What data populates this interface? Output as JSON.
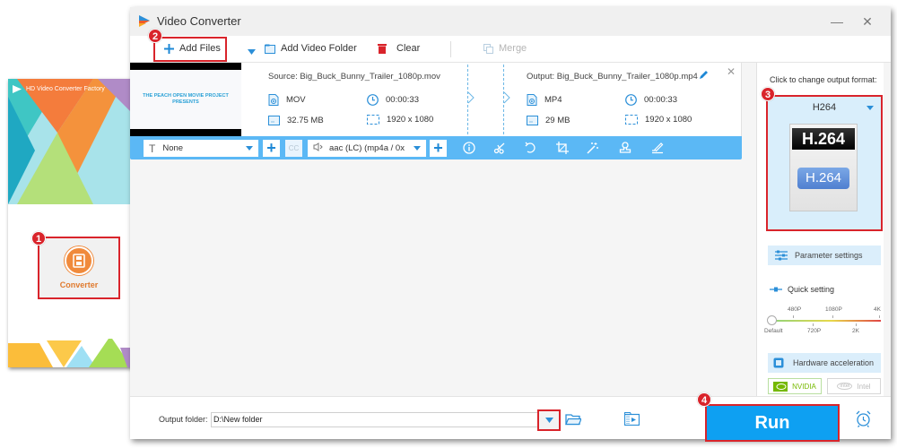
{
  "launcher": {
    "title": "HD Video Converter Factory",
    "converter_label": "Converter",
    "step_badge": "1"
  },
  "window": {
    "title": "Video Converter",
    "minimize": "—",
    "close": "✕"
  },
  "toolbar": {
    "add_files": "Add Files",
    "add_files_badge": "2",
    "add_video_folder": "Add Video Folder",
    "clear": "Clear",
    "merge": "Merge"
  },
  "file": {
    "thumbnail_text": "THE PEACH OPEN MOVIE PROJECT PRESENTS",
    "source": {
      "label": "Source: Big_Buck_Bunny_Trailer_1080p.mov",
      "format": "MOV",
      "duration": "00:00:33",
      "size": "32.75 MB",
      "resolution": "1920 x 1080"
    },
    "output": {
      "label": "Output: Big_Buck_Bunny_Trailer_1080p.mp4",
      "format": "MP4",
      "duration": "00:00:33",
      "size": "29 MB",
      "resolution": "1920 x 1080"
    },
    "close": "✕"
  },
  "editbar": {
    "subtitle_value": "None",
    "cc_label": "CC",
    "audio_value": "aac (LC) (mp4a / 0x",
    "tools": [
      "info-icon",
      "scissors-icon",
      "rotate-icon",
      "crop-icon",
      "effects-wand-icon",
      "watermark-stamp-icon",
      "edit-sign-icon"
    ]
  },
  "right_panel": {
    "change_format_label": "Click to change output format:",
    "format_name": "H264",
    "format_card_top": "H.264",
    "format_card_button": "H.264",
    "format_badge": "3",
    "parameter_settings": "Parameter settings",
    "quick_setting": "Quick setting",
    "quality_top_ticks": [
      "480P",
      "1080P",
      "4K"
    ],
    "quality_bottom_ticks": [
      "Default",
      "720P",
      "2K"
    ],
    "quality_value": "Default",
    "hardware_acceleration": "Hardware acceleration",
    "nvidia": "NVIDIA",
    "intel": "Intel",
    "intel_logo": "intel"
  },
  "bottom": {
    "output_folder_label": "Output folder:",
    "output_folder_value": "D:\\New folder",
    "run": "Run",
    "run_badge": "4"
  },
  "colors": {
    "accent_blue": "#0ea0f2",
    "highlight_red": "#d9242b",
    "converter_orange": "#f08a3c",
    "nvidia_green": "#76b900"
  }
}
